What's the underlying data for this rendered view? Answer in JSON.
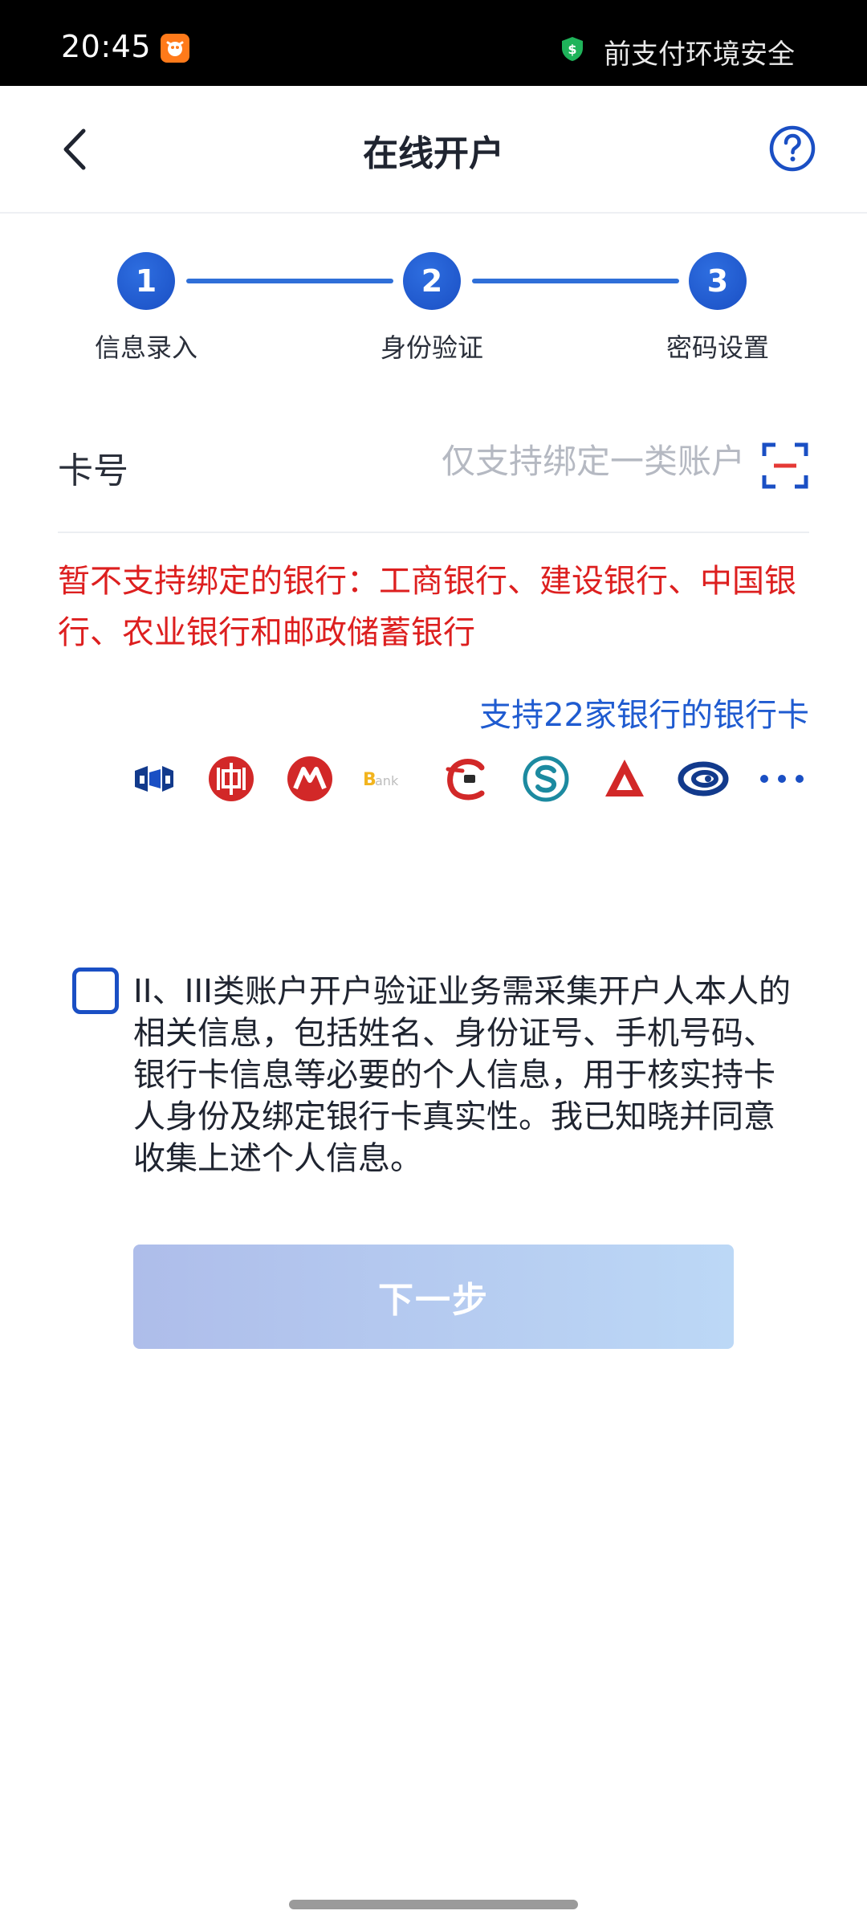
{
  "status_bar": {
    "time": "20:45",
    "app_icon": "app-icon",
    "shield_icon": "shield-icon",
    "security_text": "前支付环境安全"
  },
  "header": {
    "title": "在线开户",
    "back_icon": "chevron-left-icon",
    "help_icon": "question-circle-icon"
  },
  "stepper": {
    "steps": [
      {
        "number": "1",
        "label": "信息录入"
      },
      {
        "number": "2",
        "label": "身份验证"
      },
      {
        "number": "3",
        "label": "密码设置"
      }
    ]
  },
  "card_field": {
    "label": "卡号",
    "value": "",
    "placeholder": "仅支持绑定一类账户",
    "scan_icon": "scan-icon"
  },
  "warning": {
    "text": "暂不支持绑定的银行：工商银行、建设银行、中国银行、农业银行和邮政储蓄银行"
  },
  "support": {
    "link_text": "支持22家银行的银行卡",
    "bank_logos": [
      "spdb-logo-icon",
      "citic-logo-icon",
      "cmb-logo-icon",
      "bank-logo-icon",
      "cgb-logo-icon",
      "shbank-logo-icon",
      "pingan-logo-icon",
      "hxb-logo-icon",
      "more-dots-icon"
    ]
  },
  "consent": {
    "checked": false,
    "text": "II、III类账户开户验证业务需采集开户人本人的相关信息，包括姓名、身份证号、手机号码、银行卡信息等必要的个人信息，用于核实持卡人身份及绑定银行卡真实性。我已知晓并同意收集上述个人信息。"
  },
  "next_button": {
    "label": "下一步"
  },
  "colors": {
    "primary": "#1a4fc4",
    "warning": "#dd1f1f",
    "link": "#1f5bd0"
  }
}
